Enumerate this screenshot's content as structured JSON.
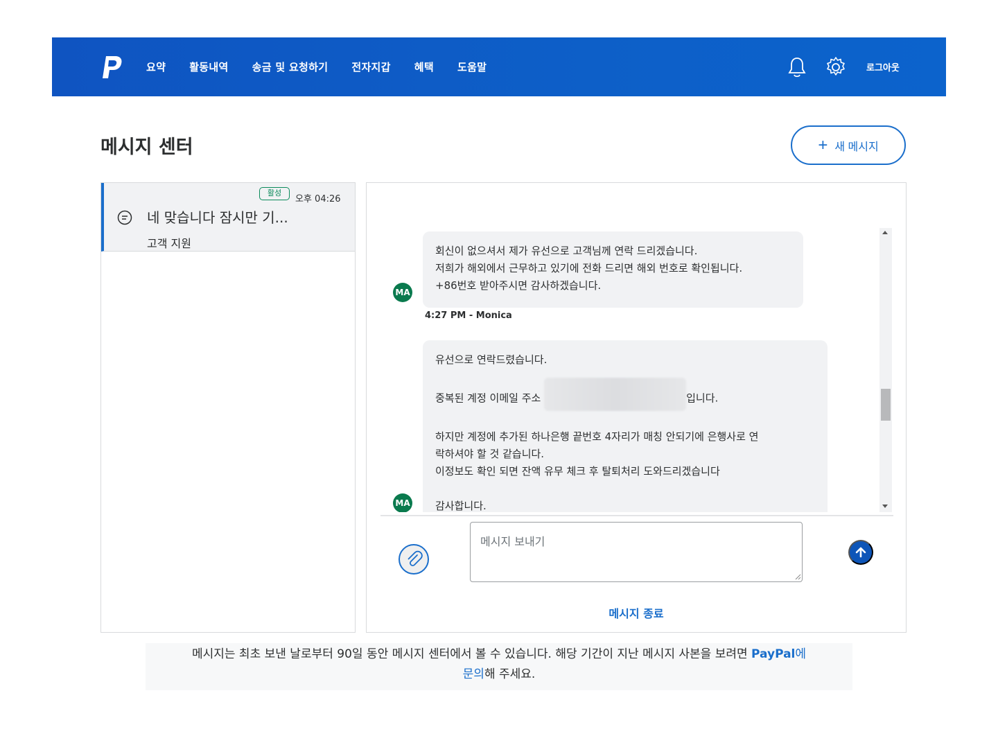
{
  "header": {
    "logo_icon": "paypal-logo-icon",
    "nav": [
      "요약",
      "활동내역",
      "송금 및 요청하기",
      "전자지갑",
      "혜택",
      "도움말"
    ],
    "logout": "로그아웃"
  },
  "page": {
    "title": "메시지 센터",
    "new_message": "새 메시지"
  },
  "conversation": {
    "badge": "활성",
    "time": "오후 04:26",
    "preview": "네 맞습니다 잠시만 기...",
    "subtitle": "고객 지원"
  },
  "messages": [
    {
      "avatar": "MA",
      "lines": [
        "회신이 없으셔서 제가 유선으로 고객님께 연락 드리겠습니다.",
        "저희가 해외에서 근무하고 있기에 전화 드리면 해외 번호로 확인됩니다.",
        "+86번호 받아주시면 감사하겠습니다."
      ],
      "meta": "4:27 PM - Monica"
    },
    {
      "avatar": "MA",
      "line1": "유선으로 연락드렸습니다.",
      "line2_prefix": "중복된 계정 이메일 주소",
      "line2_suffix": "입니다.",
      "line3": "하지만 계정에 추가된 하나은행 끝번호 4자리가 매칭 안되기에 은행사로 연",
      "line4": "락하셔야 할 것 같습니다.",
      "line5": "이정보도 확인 되면 잔액 유무 체크 후 탈퇴처리 도와드리겠습니다",
      "line6": "감사합니다."
    }
  ],
  "composer": {
    "placeholder": "메시지 보내기",
    "end_chat": "메시지 종료"
  },
  "footnote": {
    "text1": "메시지는 최초 보낸 날로부터 90일 동안 메시지 센터에서 볼 수 있습니다. 해당 기간이 지난 메시지 사본을 보려면 ",
    "brand": "PayPal",
    "link1": "에",
    "link2": "문의",
    "text2": "해 주세요."
  },
  "colors": {
    "header_blue": "#0f54c1",
    "accent": "#1a6ecb",
    "avatar_green": "#0a7a4e"
  }
}
